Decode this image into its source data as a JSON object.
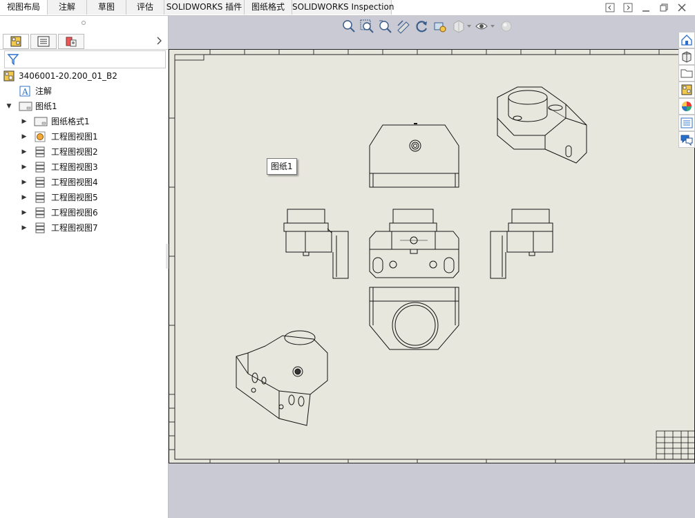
{
  "tabs": [
    {
      "label": "视图布局",
      "active": true
    },
    {
      "label": "注解",
      "active": false
    },
    {
      "label": "草图",
      "active": false
    },
    {
      "label": "评估",
      "active": false
    },
    {
      "label": "SOLIDWORKS 插件",
      "active": false
    },
    {
      "label": "图纸格式",
      "active": false
    },
    {
      "label": "SOLIDWORKS Inspection",
      "active": false
    }
  ],
  "tree": {
    "root": "3406001-20.200_01_B2",
    "annotations": "注解",
    "sheet": "图纸1",
    "sheet_format": "图纸格式1",
    "views": [
      "工程图视图1",
      "工程图视图2",
      "工程图视图3",
      "工程图视图4",
      "工程图视图5",
      "工程图视图6",
      "工程图视图7"
    ]
  },
  "tooltip": "图纸1",
  "colors": {
    "sheet": "#e8e7de",
    "canvas_bg": "#c9cad3",
    "accent_yellow": "#f2c94c",
    "accent_blue": "#2a6fc9"
  },
  "icons": {
    "toolbar": [
      "zoom-to-fit-icon",
      "zoom-area-icon",
      "previous-view-icon",
      "section-view-icon",
      "rotate-icon",
      "view-orientation-icon",
      "display-style-icon",
      "hide-show-icon",
      "appearance-icon"
    ],
    "right_panel": [
      "home-icon",
      "3d-part-icon",
      "folder-icon",
      "view-palette-icon",
      "appearances-icon",
      "custom-properties-icon",
      "forum-icon"
    ]
  }
}
